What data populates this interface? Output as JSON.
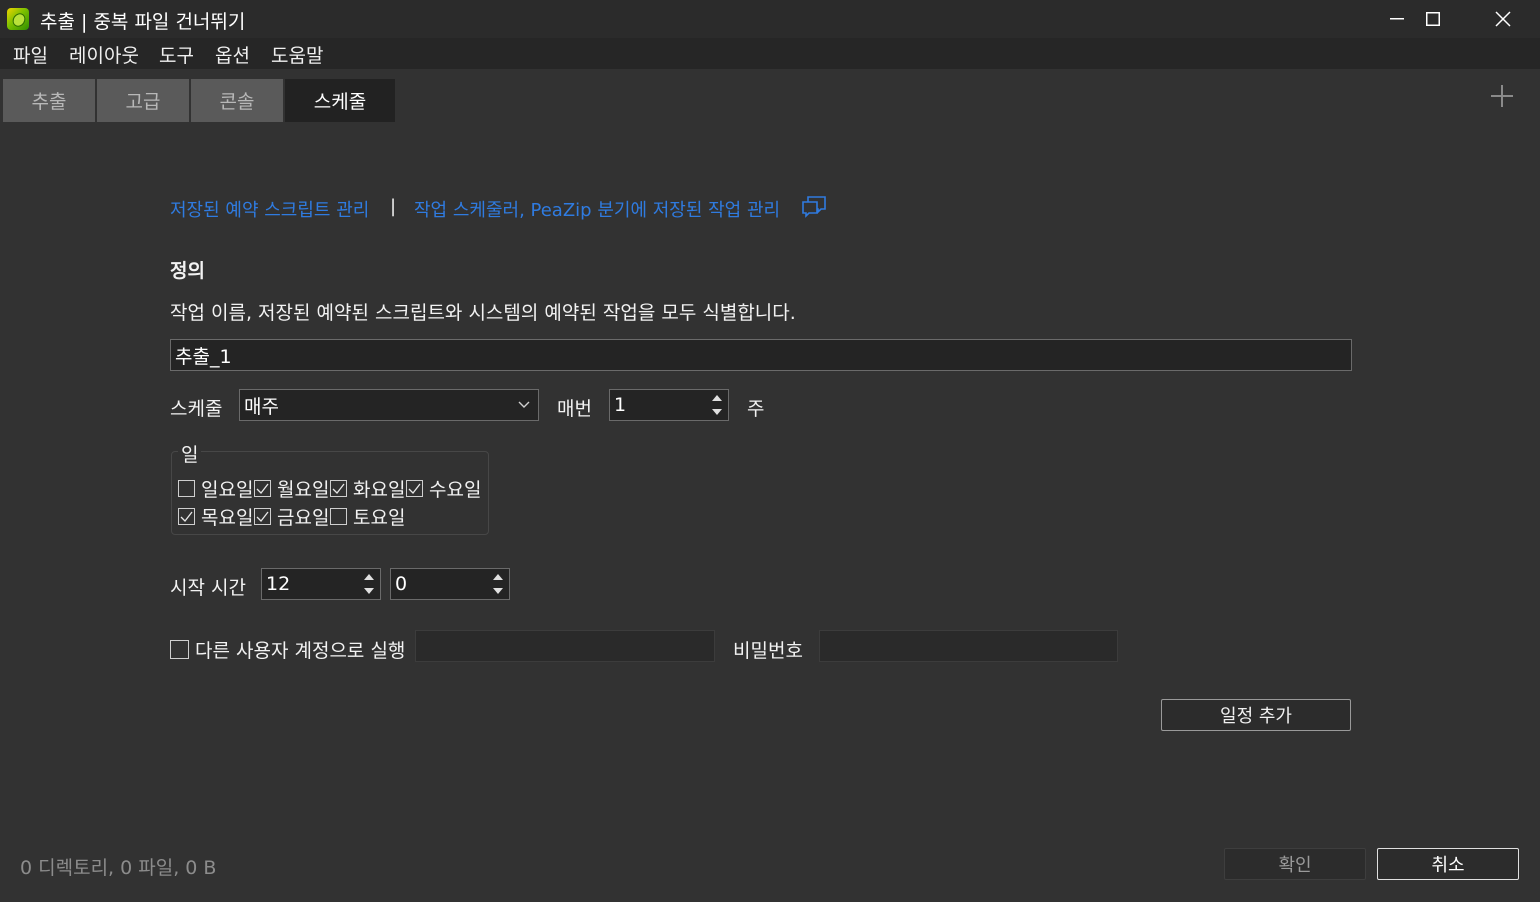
{
  "window": {
    "title": "추출 | 중복 파일 건너뛰기"
  },
  "menu": [
    "파일",
    "레이아웃",
    "도구",
    "옵션",
    "도움말"
  ],
  "tabs": [
    {
      "label": "추출",
      "active": false
    },
    {
      "label": "고급",
      "active": false
    },
    {
      "label": "콘솔",
      "active": false
    },
    {
      "label": "스케줄",
      "active": true
    }
  ],
  "links": {
    "manage_scripts": "저장된 예약 스크립트 관리",
    "separator": "|",
    "manage_tasks": "작업 스케줄러, PeaZip 분기에 저장된 작업 관리"
  },
  "definition": {
    "heading": "정의",
    "description": "작업 이름, 저장된 예약된 스크립트와 시스템의 예약된 작업을 모두 식별합니다.",
    "name_value": "추출_1"
  },
  "schedule": {
    "label": "스케줄",
    "selected": "매주",
    "every_label": "매번",
    "every_value": "1",
    "unit": "주"
  },
  "days": {
    "group_label": "일",
    "items": [
      {
        "label": "일요일",
        "checked": false
      },
      {
        "label": "월요일",
        "checked": true
      },
      {
        "label": "화요일",
        "checked": true
      },
      {
        "label": "수요일",
        "checked": true
      },
      {
        "label": "목요일",
        "checked": true
      },
      {
        "label": "금요일",
        "checked": true
      },
      {
        "label": "토요일",
        "checked": false
      }
    ]
  },
  "start_time": {
    "label": "시작 시간",
    "hour": "12",
    "minute": "0"
  },
  "run_as": {
    "label": "다른 사용자 계정으로 실행",
    "checked": false,
    "user_value": "",
    "password_label": "비밀번호",
    "password_value": ""
  },
  "buttons": {
    "add_schedule": "일정 추가",
    "ok": "확인",
    "cancel": "취소"
  },
  "status": "0 디렉토리, 0 파일, 0 B",
  "colors": {
    "background": "#323232",
    "link": "#2f7be0",
    "active_tab": "#222222",
    "inactive_tab": "#5a5a5a"
  }
}
